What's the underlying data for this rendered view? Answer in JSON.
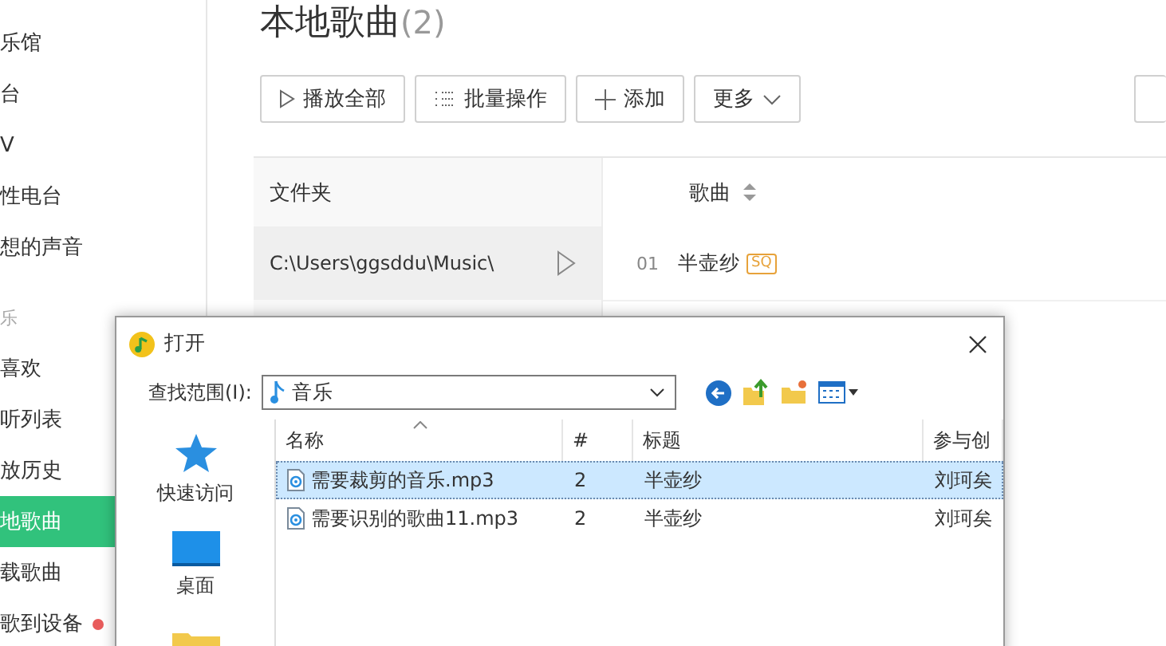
{
  "sidebar": {
    "items": [
      {
        "kind": "item",
        "label": "乐馆",
        "selected": false,
        "dot": false
      },
      {
        "kind": "item",
        "label": "台",
        "selected": false,
        "dot": false
      },
      {
        "kind": "item",
        "label": "V",
        "selected": false,
        "dot": false
      },
      {
        "kind": "item",
        "label": "性电台",
        "selected": false,
        "dot": false
      },
      {
        "kind": "item",
        "label": "想的声音",
        "selected": false,
        "dot": false
      },
      {
        "kind": "header",
        "label": "乐"
      },
      {
        "kind": "item",
        "label": "喜欢",
        "selected": false,
        "dot": false
      },
      {
        "kind": "item",
        "label": "听列表",
        "selected": false,
        "dot": false
      },
      {
        "kind": "item",
        "label": "放历史",
        "selected": false,
        "dot": false
      },
      {
        "kind": "item",
        "label": "地歌曲",
        "selected": true,
        "dot": false
      },
      {
        "kind": "item",
        "label": "载歌曲",
        "selected": false,
        "dot": false
      },
      {
        "kind": "item",
        "label": "歌到设备",
        "selected": false,
        "dot": true
      }
    ]
  },
  "page": {
    "title": "本地歌曲",
    "count": "(2)"
  },
  "toolbar": [
    {
      "kind": "play",
      "label": "播放全部"
    },
    {
      "kind": "batch",
      "label": "批量操作"
    },
    {
      "kind": "add",
      "label": "添加"
    },
    {
      "kind": "more",
      "label": "更多"
    }
  ],
  "folders": {
    "header": "文件夹",
    "rows": [
      {
        "path": "C:\\Users\\ggsddu\\Music\\"
      }
    ]
  },
  "songs": {
    "header": "歌曲",
    "rows": [
      {
        "index": "01",
        "title": "半壶纱",
        "badge": "SQ"
      }
    ]
  },
  "dialog": {
    "title": "打开",
    "look_in_label": "查找范围(I):",
    "look_in_value": "音乐",
    "places": [
      {
        "kind": "star",
        "label": "快速访问"
      },
      {
        "kind": "desktop",
        "label": "桌面"
      },
      {
        "kind": "folder"
      }
    ],
    "columns": [
      "名称",
      "#",
      "标题",
      "参与创"
    ],
    "rows": [
      {
        "name": "需要裁剪的音乐.mp3",
        "number": "2",
        "title": "半壶纱",
        "artist": "刘珂矣",
        "selected": true
      },
      {
        "name": "需要识别的歌曲11.mp3",
        "number": "2",
        "title": "半壶纱",
        "artist": "刘珂矣",
        "selected": false
      }
    ]
  }
}
